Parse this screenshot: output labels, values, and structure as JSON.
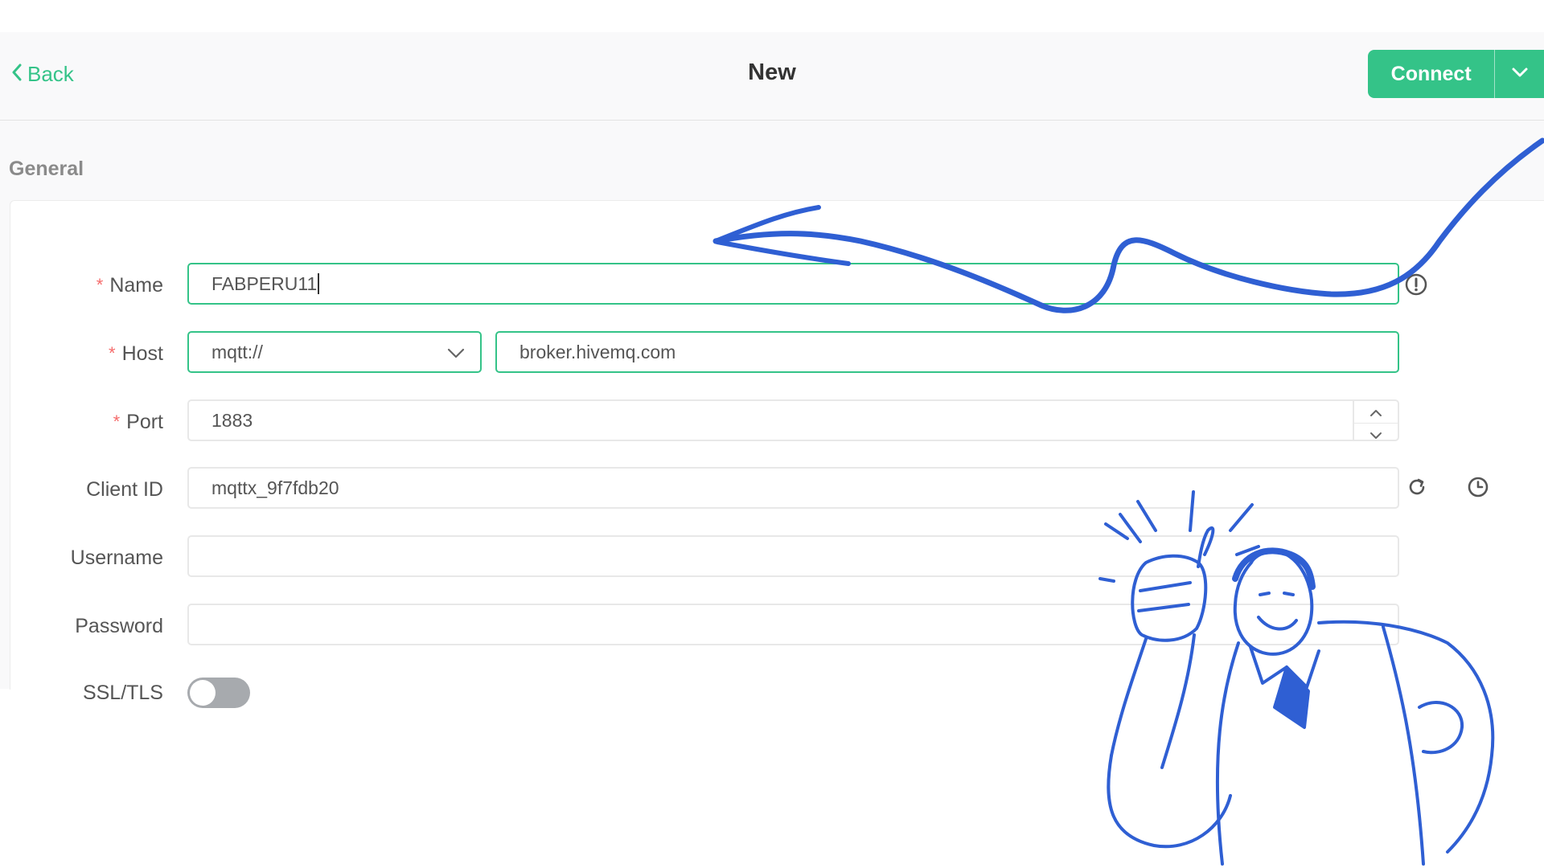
{
  "header": {
    "back_label": "Back",
    "title": "New",
    "connect_label": "Connect"
  },
  "section": {
    "general_label": "General"
  },
  "form": {
    "name": {
      "label": "Name",
      "required": "*",
      "value": "FABPERU11"
    },
    "host": {
      "label": "Host",
      "required": "*",
      "protocol": "mqtt://",
      "value": "broker.hivemq.com"
    },
    "port": {
      "label": "Port",
      "required": "*",
      "value": "1883"
    },
    "client_id": {
      "label": "Client ID",
      "value": "mqttx_9f7fdb20"
    },
    "username": {
      "label": "Username",
      "value": ""
    },
    "password": {
      "label": "Password",
      "value": ""
    },
    "ssl": {
      "label": "SSL/TLS",
      "enabled": false
    }
  },
  "icons": {
    "back": "chevron-left-icon",
    "connect_dropdown": "chevron-down-icon",
    "protocol_dropdown": "chevron-down-icon",
    "port_increment": "chevron-up-icon",
    "port_decrement": "chevron-down-icon",
    "name_info": "info-icon",
    "client_id_refresh": "refresh-icon",
    "client_id_time": "clock-icon"
  },
  "colors": {
    "accent": "#34c388",
    "required": "#f56c6c",
    "annotation": "#2f5fd3",
    "toggle_off": "#a7aaae"
  }
}
